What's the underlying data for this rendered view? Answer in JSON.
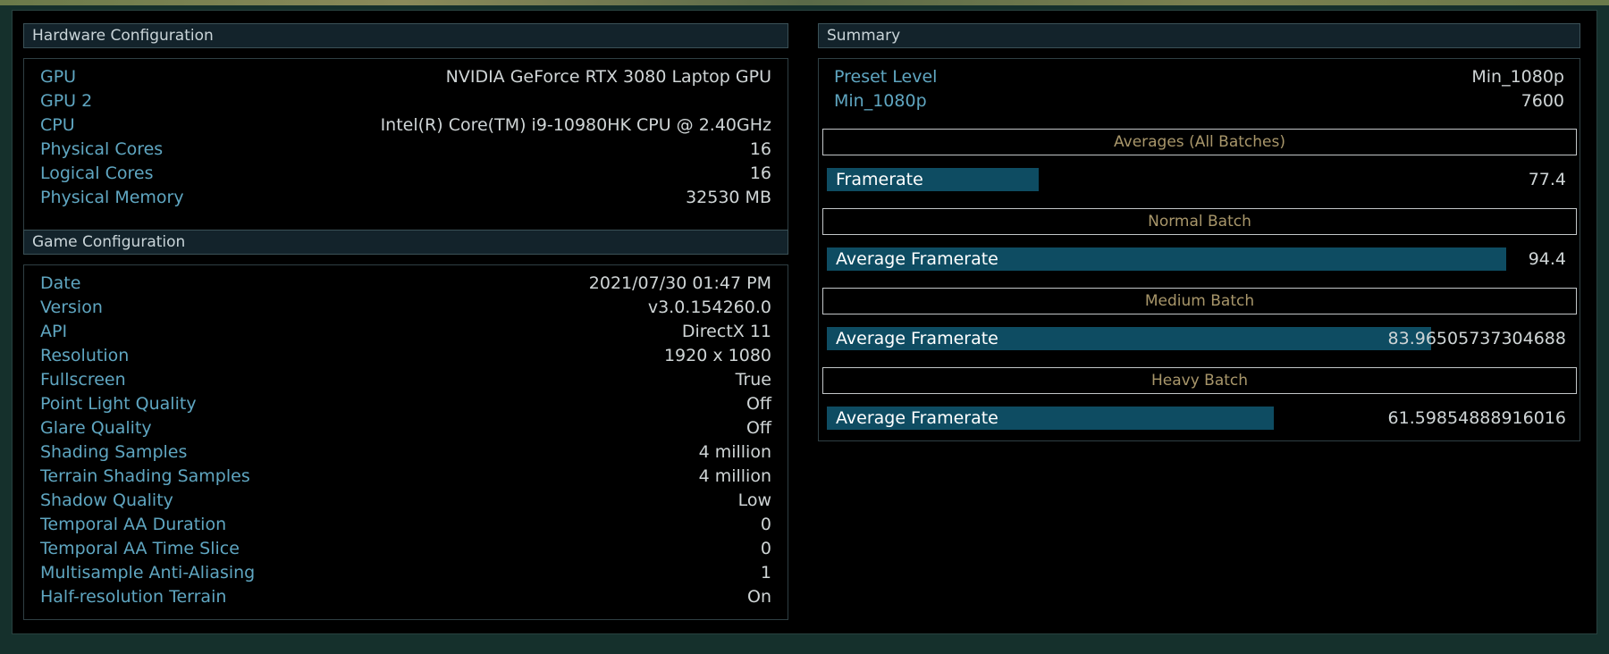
{
  "colors": {
    "key_text": "#5fa6c1",
    "value_text": "#cfd5d6",
    "batch_title": "#a8966a",
    "bar_fill": "#0e4c62",
    "background": "#000000"
  },
  "hardware": {
    "title": "Hardware Configuration",
    "rows": [
      {
        "key": "GPU",
        "value": "NVIDIA GeForce RTX 3080 Laptop GPU"
      },
      {
        "key": "GPU 2",
        "value": ""
      },
      {
        "key": "CPU",
        "value": "Intel(R) Core(TM) i9-10980HK CPU @ 2.40GHz"
      },
      {
        "key": "Physical Cores",
        "value": "16"
      },
      {
        "key": "Logical Cores",
        "value": "16"
      },
      {
        "key": "Physical Memory",
        "value": "32530 MB"
      }
    ]
  },
  "game": {
    "title": "Game Configuration",
    "rows": [
      {
        "key": "Date",
        "value": "2021/07/30 01:47 PM"
      },
      {
        "key": "Version",
        "value": "v3.0.154260.0"
      },
      {
        "key": "API",
        "value": "DirectX 11"
      },
      {
        "key": "Resolution",
        "value": "1920 x 1080"
      },
      {
        "key": "Fullscreen",
        "value": "True"
      },
      {
        "key": "Point Light Quality",
        "value": "Off"
      },
      {
        "key": "Glare Quality",
        "value": "Off"
      },
      {
        "key": "Shading Samples",
        "value": "4 million"
      },
      {
        "key": "Terrain Shading Samples",
        "value": "4 million"
      },
      {
        "key": "Shadow Quality",
        "value": "Low"
      },
      {
        "key": "Temporal AA Duration",
        "value": "0"
      },
      {
        "key": "Temporal AA Time Slice",
        "value": "0"
      },
      {
        "key": "Multisample Anti-Aliasing",
        "value": "1"
      },
      {
        "key": "Half-resolution Terrain",
        "value": "On"
      }
    ]
  },
  "summary": {
    "title": "Summary",
    "preset": {
      "key": "Preset Level",
      "value": "Min_1080p"
    },
    "score": {
      "key": "Min_1080p",
      "value": "7600"
    },
    "averages": {
      "title": "Averages (All Batches)",
      "label": "Framerate",
      "value": "77.4",
      "fill_fraction": 0.286
    },
    "batches": [
      {
        "title": "Normal Batch",
        "label": "Average Framerate",
        "value": "94.4",
        "fill_fraction": 0.919
      },
      {
        "title": "Medium Batch",
        "label": "Average Framerate",
        "value": "83.96505737304688",
        "fill_fraction": 0.818
      },
      {
        "title": "Heavy Batch",
        "label": "Average Framerate",
        "value": "61.59854888916016",
        "fill_fraction": 0.605
      }
    ]
  }
}
